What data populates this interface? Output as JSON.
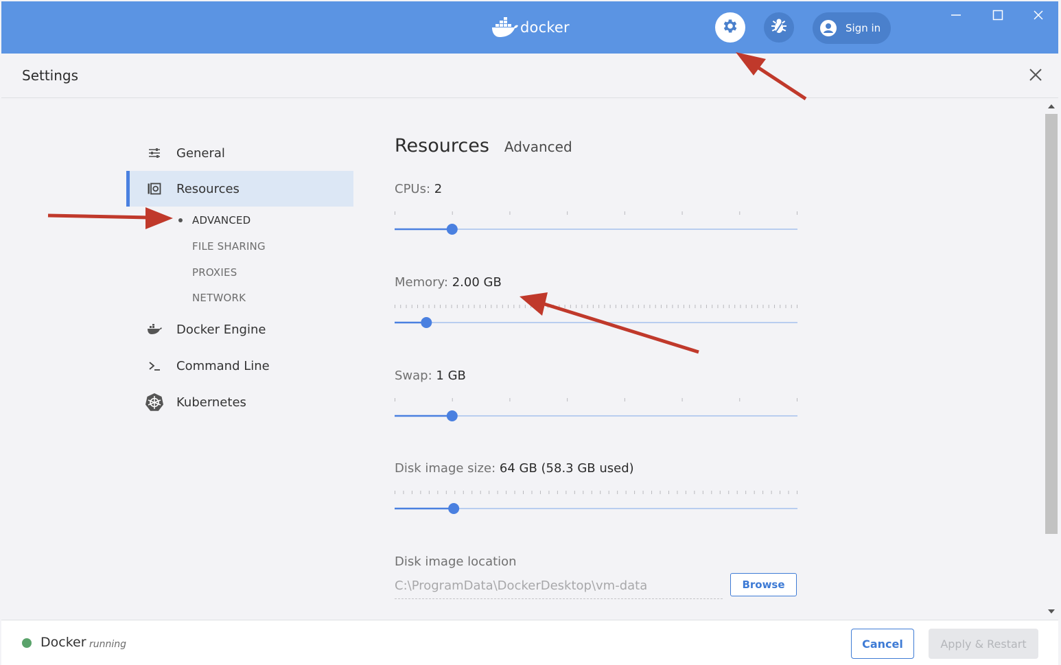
{
  "app": {
    "logo_text": "docker",
    "signin_label": "Sign in",
    "icons": {
      "logo": "docker-whale-icon",
      "settings": "gear-icon",
      "troubleshoot": "bug-icon",
      "account": "user-icon",
      "minimize": "minimize-icon",
      "maximize": "maximize-icon",
      "close": "close-icon"
    }
  },
  "header": {
    "title": "Settings"
  },
  "sidebar": {
    "items": [
      {
        "label": "General",
        "icon": "sliders-icon"
      },
      {
        "label": "Resources",
        "icon": "resources-icon",
        "active": true
      },
      {
        "label": "Docker Engine",
        "icon": "whale-icon"
      },
      {
        "label": "Command Line",
        "icon": "terminal-icon"
      },
      {
        "label": "Kubernetes",
        "icon": "kubernetes-icon"
      }
    ],
    "subitems": [
      {
        "label": "ADVANCED",
        "current": true
      },
      {
        "label": "FILE SHARING"
      },
      {
        "label": "PROXIES"
      },
      {
        "label": "NETWORK"
      }
    ]
  },
  "content": {
    "title": "Resources",
    "subtitle": "Advanced",
    "cpus": {
      "label": "CPUs:",
      "value": "2",
      "fraction": 0.143,
      "ticks": 8
    },
    "memory": {
      "label": "Memory:",
      "value": "2.00 GB",
      "fraction": 0.079,
      "ticks": 72
    },
    "swap": {
      "label": "Swap:",
      "value": "1 GB",
      "fraction": 0.143,
      "ticks": 8
    },
    "disk_size": {
      "label": "Disk image size:",
      "value": "64 GB (58.3 GB used)",
      "fraction": 0.147,
      "ticks": 48
    },
    "disk_location": {
      "label": "Disk image location",
      "value": "C:\\ProgramData\\DockerDesktop\\vm-data",
      "browse_label": "Browse"
    }
  },
  "footer": {
    "app_name": "Docker",
    "status": "running",
    "status_color": "#5aa36b",
    "cancel_label": "Cancel",
    "apply_label": "Apply & Restart"
  },
  "colors": {
    "titlebar": "#5b94e3",
    "accent": "#3e7bd5",
    "slider": "#4a80e0",
    "annotation_arrow": "#c0392b"
  }
}
